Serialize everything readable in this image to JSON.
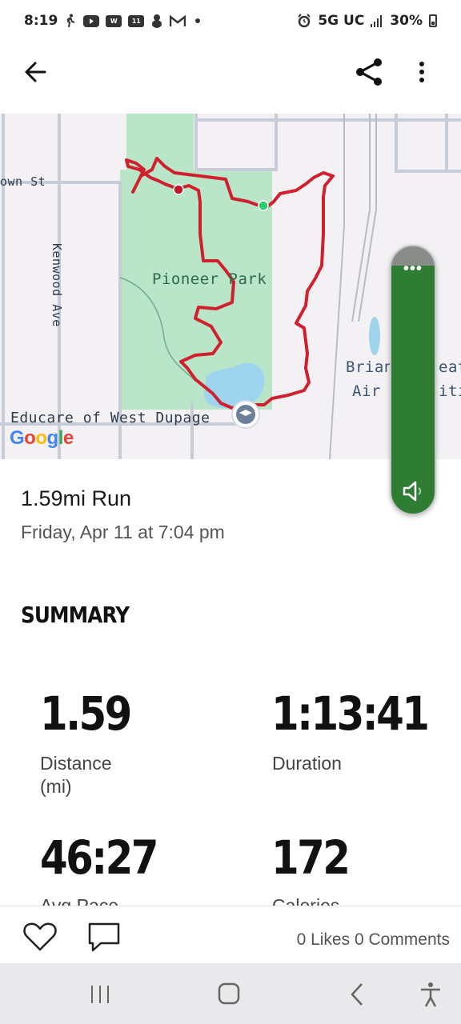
{
  "status_bar": {
    "time": "8:19",
    "network": "5G UC",
    "battery": "30%",
    "icons": [
      "walking-icon",
      "youtube-icon",
      "webtoon-icon",
      "calendar-icon",
      "pokemon-icon",
      "gmail-icon",
      "dot-icon",
      "alarm-icon",
      "signal-icon",
      "battery-icon"
    ]
  },
  "app_bar": {
    "back_icon": "arrow-left-icon",
    "share_icon": "share-icon",
    "more_icon": "more-vertical-icon"
  },
  "map": {
    "labels": {
      "park": "Pioneer Park",
      "street_top": "own St",
      "street_side": "Kenwood Ave",
      "poi_bottom": "Educare of West Dupage",
      "poi_right_line1": "Brian",
      "poi_right_line1_tail": "eati",
      "poi_right_line2": "Air",
      "poi_right_line2_tail": "iti"
    },
    "attribution": "Google",
    "route_color": "#d0202e",
    "start_marker_color": "#2ecc71",
    "end_marker_color": "#c0172a",
    "park_color": "#b9e5c8",
    "water_color": "#9ed4ee"
  },
  "floating_control": {
    "menu_icon": "more-horizontal-icon",
    "speaker_icon": "speaker-icon",
    "color": "#2f7d32"
  },
  "activity": {
    "title": "1.59mi Run",
    "datetime": "Friday, Apr 11 at 7:04 pm"
  },
  "summary": {
    "heading": "SUMMARY",
    "stats": [
      {
        "value": "1.59",
        "label": "Distance\n(mi)"
      },
      {
        "value": "1:13:41",
        "label": "Duration"
      },
      {
        "value": "46:27",
        "label": "Avg Pace"
      },
      {
        "value": "172",
        "label": "Calories"
      }
    ]
  },
  "actions": {
    "like_icon": "heart-icon",
    "comment_icon": "comment-icon",
    "counts": "0 Likes 0 Comments"
  },
  "nav_bar": {
    "recent_icon": "recent-apps-icon",
    "home_icon": "home-icon",
    "back_icon": "back-icon",
    "accessibility_icon": "accessibility-icon"
  }
}
